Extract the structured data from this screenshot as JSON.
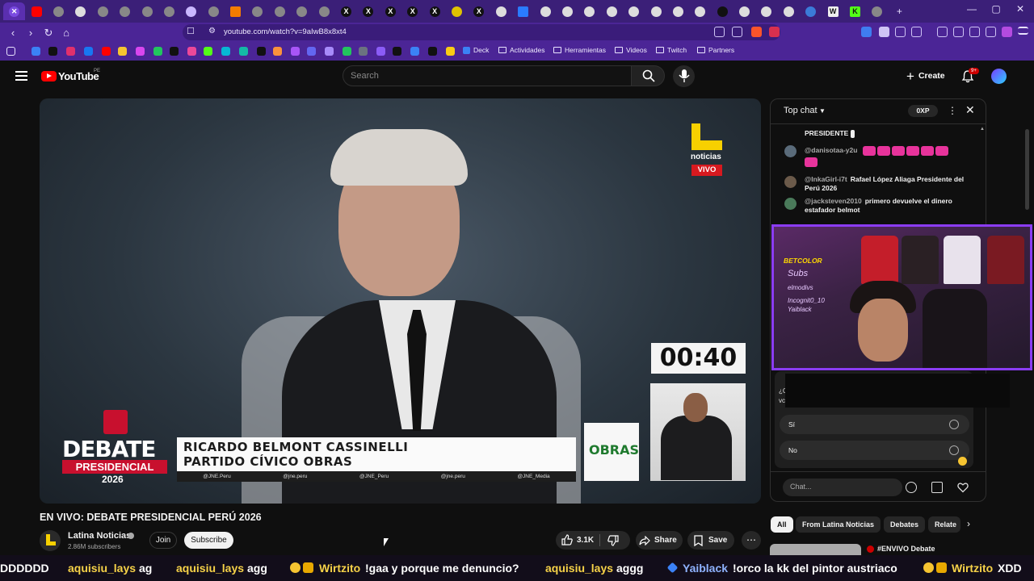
{
  "browser": {
    "url": "youtube.com/watch?v=9aIwB8x8xt4",
    "window_controls": [
      "—",
      "▢",
      "✕"
    ],
    "tab_count": 42,
    "bookmark_folders": [
      "Deck",
      "Actividades",
      "Herramientas",
      "Videos",
      "Twitch",
      "Partners"
    ]
  },
  "youtube": {
    "logo_text": "YouTube",
    "region": "PE",
    "search_placeholder": "Search",
    "create_label": "Create",
    "notifications_badge": "9+"
  },
  "video": {
    "title": "EN VIVO: DEBATE PRESIDENCIAL PERÚ 2026",
    "overlay": {
      "brand": "noticias",
      "live_tag": "VIVO",
      "timer": "00:40",
      "debate_word": "DEBATE",
      "presidencial_word": "PRESIDENCIAL",
      "year": "2026",
      "speaker_name": "RICARDO BELMONT CASSINELLI",
      "speaker_party": "PARTIDO CÍVICO OBRAS",
      "party_logo_text": "OBRAS",
      "socials": [
        "@JNE.Peru",
        "@jne.peru",
        "@JNE_Peru",
        "@jne.peru",
        "@JNE_Media"
      ]
    }
  },
  "channel": {
    "name": "Latina Noticias",
    "subscribers": "2.86M subscribers",
    "join_label": "Join",
    "subscribe_label": "Subscribe"
  },
  "actions": {
    "likes": "3.1K",
    "share_label": "Share",
    "save_label": "Save",
    "more_label": "⋯"
  },
  "chat": {
    "mode": "Top chat",
    "points_badge": "0XP",
    "messages": [
      {
        "author": "",
        "text": "PRESIDENTE",
        "avatar_color": "#7a6a5a"
      },
      {
        "author": "@danisotaa-y2u",
        "text": "",
        "avatar_color": "#5a6b7a"
      },
      {
        "author": "@InkaGirl-i7t",
        "text": "Rafael López Aliaga Presidente del Perú 2026",
        "avatar_color": "#6b5a4a"
      },
      {
        "author": "@jacksteven2010",
        "text": "primero devuelve el dinero estafador belmot",
        "avatar_color": "#4a7a5a"
      }
    ],
    "poll": {
      "question_start": "¿C",
      "question_line2": "vc",
      "options": [
        "Sí",
        "No"
      ]
    },
    "input_placeholder": "Chat..."
  },
  "streamer_cam": {
    "brand": "BETCOLOR",
    "overlay_lines": [
      "Subs",
      "elmodivs",
      "Incognit0_10",
      "Yaiblack"
    ]
  },
  "chips": [
    "All",
    "From Latina Noticias",
    "Debates",
    "Relate"
  ],
  "recommended": {
    "title": "#ENVIVO Debate"
  },
  "ticker": [
    {
      "user": "",
      "message": "DDDDDD"
    },
    {
      "user": "aquisiu_lays",
      "message": "ag"
    },
    {
      "user": "aquisiu_lays",
      "message": "agg"
    },
    {
      "user": "Wirtzito",
      "message": "!gaa y porque me denuncio?"
    },
    {
      "user": "aquisiu_lays",
      "message": "aggg"
    },
    {
      "user": "Yaiblack",
      "message": "!orco la kk del pintor austriaco"
    },
    {
      "user": "Wirtzito",
      "message": "XDD"
    }
  ]
}
